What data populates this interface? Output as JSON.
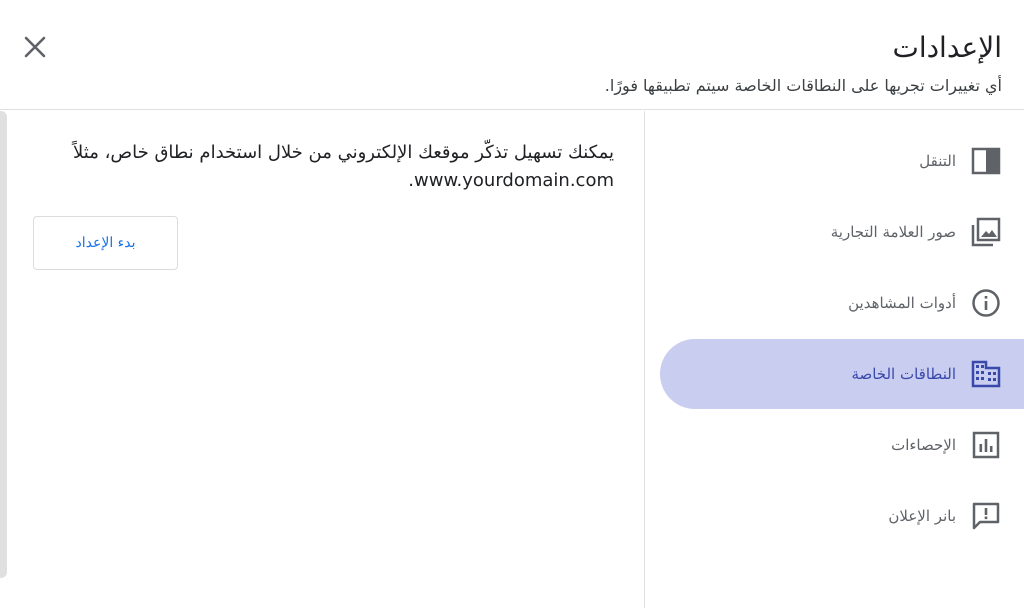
{
  "header": {
    "title": "الإعدادات",
    "subtitle": "أي تغييرات تجريها على النطاقات الخاصة سيتم تطبيقها فورًا."
  },
  "sidebar": {
    "items": [
      {
        "label": "التنقل",
        "icon": "navigation-panel-icon",
        "active": false
      },
      {
        "label": "صور العلامة التجارية",
        "icon": "brand-images-icon",
        "active": false
      },
      {
        "label": "أدوات المشاهدين",
        "icon": "info-icon",
        "active": false
      },
      {
        "label": "النطاقات الخاصة",
        "icon": "domain-building-icon",
        "active": true
      },
      {
        "label": "الإحصاءات",
        "icon": "analytics-chart-icon",
        "active": false
      },
      {
        "label": "بانر الإعلان",
        "icon": "announcement-icon",
        "active": false
      }
    ]
  },
  "main": {
    "description": "يمكنك تسهيل تذكّر موقعك الإلكتروني من خلال استخدام نطاق خاص، مثلاً www.yourdomain.com.",
    "setup_button": "بدء الإعداد"
  },
  "colors": {
    "accent": "#3949ab",
    "active_background": "#c9cdf0",
    "link_blue": "#1a73e8"
  }
}
